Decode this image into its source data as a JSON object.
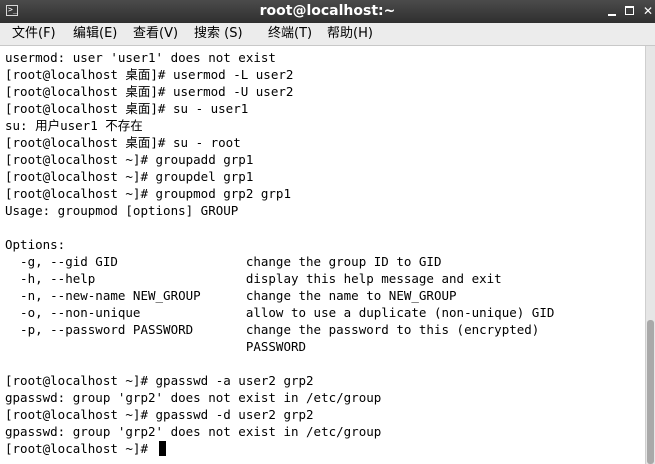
{
  "window": {
    "title": "root@localhost:~",
    "app_icon_glyph": ">_"
  },
  "menubar": {
    "items": [
      {
        "label": "文件(F)"
      },
      {
        "label": "编辑(E)"
      },
      {
        "label": "查看(V)"
      },
      {
        "label": "搜索 (S)"
      },
      {
        "label": "终端(T)"
      },
      {
        "label": "帮助(H)"
      }
    ]
  },
  "terminal": {
    "lines": [
      "usermod: user 'user1' does not exist",
      "[root@localhost 桌面]# usermod -L user2",
      "[root@localhost 桌面]# usermod -U user2",
      "[root@localhost 桌面]# su - user1",
      "su: 用户user1 不存在",
      "[root@localhost 桌面]# su - root",
      "[root@localhost ~]# groupadd grp1",
      "[root@localhost ~]# groupdel grp1",
      "[root@localhost ~]# groupmod grp2 grp1",
      "Usage: groupmod [options] GROUP",
      "",
      "Options:",
      "  -g, --gid GID                 change the group ID to GID",
      "  -h, --help                    display this help message and exit",
      "  -n, --new-name NEW_GROUP      change the name to NEW_GROUP",
      "  -o, --non-unique              allow to use a duplicate (non-unique) GID",
      "  -p, --password PASSWORD       change the password to this (encrypted)",
      "                                PASSWORD",
      "",
      "[root@localhost ~]# gpasswd -a user2 grp2",
      "gpasswd: group 'grp2' does not exist in /etc/group",
      "[root@localhost ~]# gpasswd -d user2 grp2",
      "gpasswd: group 'grp2' does not exist in /etc/group",
      "[root@localhost ~]# "
    ]
  },
  "colors": {
    "titlebar": "#3a3a3a",
    "menubar": "#ececec",
    "terminal_bg": "#ffffff",
    "terminal_fg": "#000000"
  }
}
